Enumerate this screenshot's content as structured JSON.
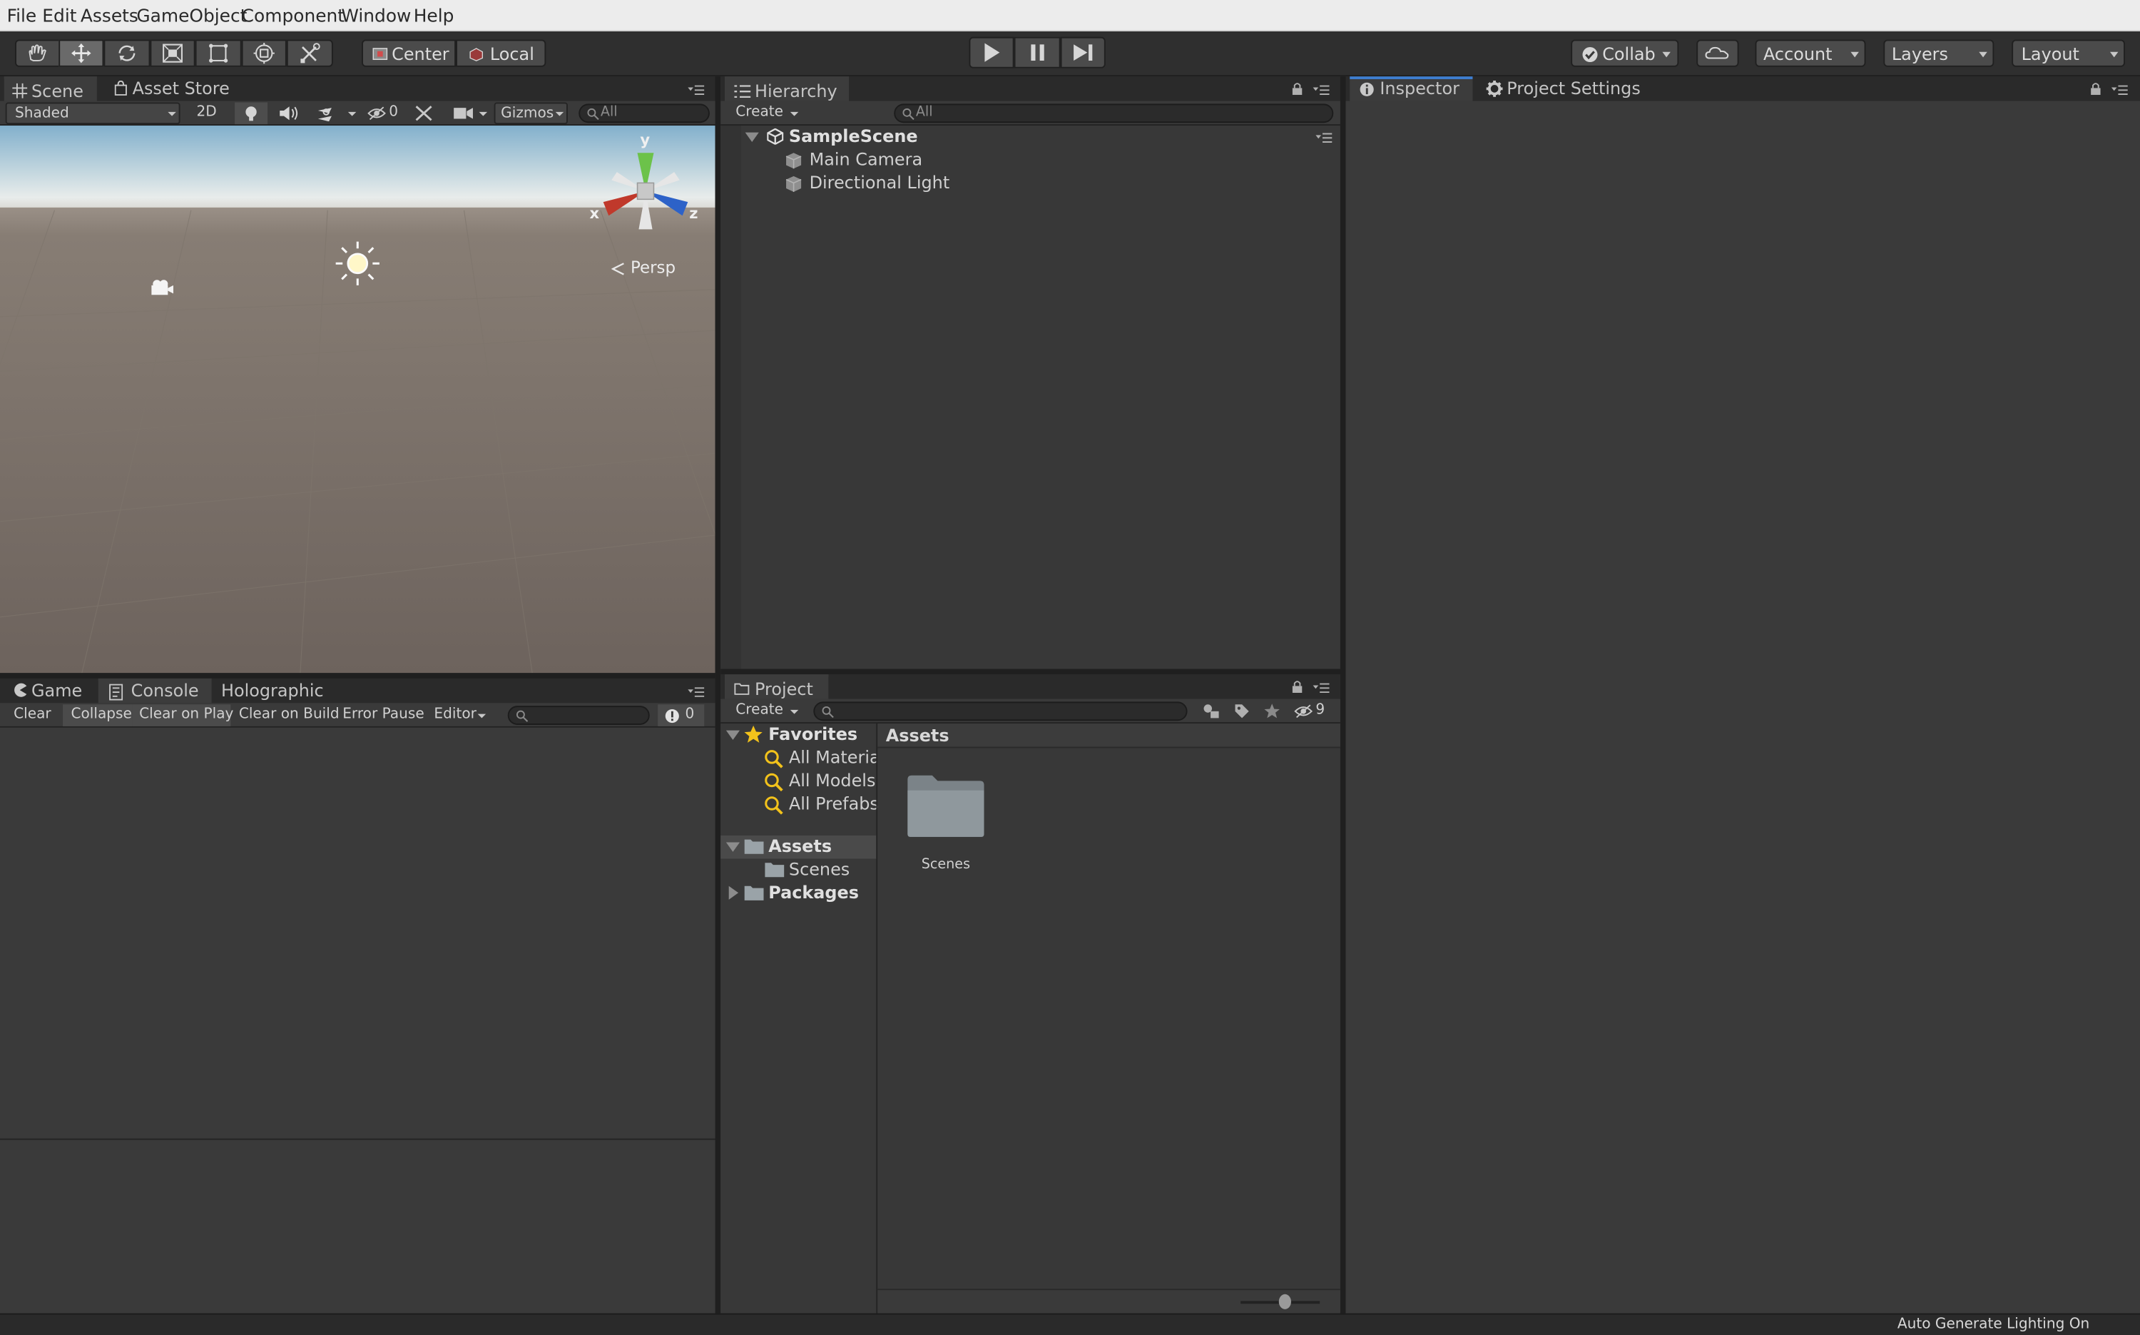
{
  "menu": [
    "File",
    "Edit",
    "Assets",
    "GameObject",
    "Component",
    "Window",
    "Help"
  ],
  "toolbar": {
    "tools": [
      "hand-tool",
      "move-tool",
      "rotate-tool",
      "scale-tool",
      "rect-tool",
      "transform-tool",
      "custom-tool"
    ],
    "pivot_center": "Center",
    "pivot_local": "Local",
    "collab": "Collab",
    "account": "Account",
    "layers": "Layers",
    "layout": "Layout"
  },
  "scene_panel": {
    "tabs": [
      "Scene",
      "Asset Store"
    ],
    "shading": "Shaded",
    "mode_2d": "2D",
    "hidden_count": "0",
    "gizmos": "Gizmos",
    "search_placeholder": "All",
    "axis_x": "x",
    "axis_y": "y",
    "axis_z": "z",
    "projection": "Persp"
  },
  "hierarchy": {
    "tab": "Hierarchy",
    "create": "Create",
    "search_placeholder": "All",
    "scene": "SampleScene",
    "items": [
      "Main Camera",
      "Directional Light"
    ]
  },
  "inspector": {
    "tabs": [
      "Inspector",
      "Project Settings"
    ]
  },
  "console": {
    "tabs": [
      "Game",
      "Console",
      "Holographic"
    ],
    "buttons": [
      "Clear",
      "Collapse",
      "Clear on Play",
      "Clear on Build",
      "Error Pause",
      "Editor"
    ],
    "error_count": "0"
  },
  "project": {
    "tab": "Project",
    "create": "Create",
    "hidden_count": "9",
    "favorites": "Favorites",
    "favorite_items": [
      "All Material",
      "All Models",
      "All Prefabs"
    ],
    "assets": "Assets",
    "asset_children": [
      "Scenes"
    ],
    "packages": "Packages",
    "breadcrumb": "Assets",
    "folder": "Scenes"
  },
  "status": "Auto Generate Lighting On"
}
